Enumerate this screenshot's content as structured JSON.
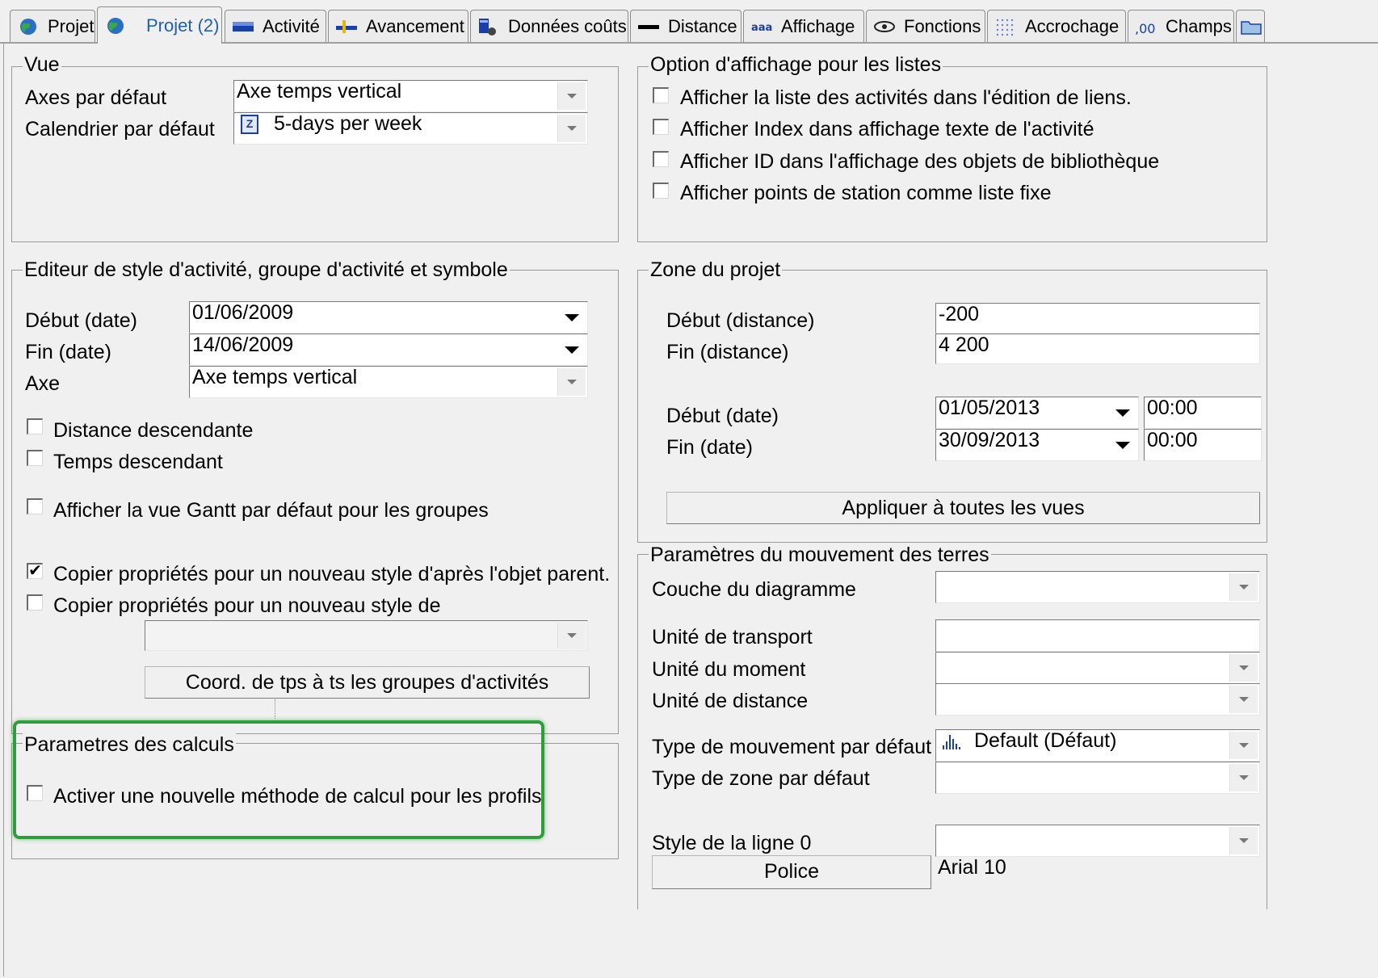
{
  "tabs": [
    {
      "label": "Projet",
      "icon": "globe-icon"
    },
    {
      "label": "Projet (2)",
      "icon": "globe-icon",
      "active": true
    },
    {
      "label": "Activité",
      "icon": "activity-bar-icon"
    },
    {
      "label": "Avancement",
      "icon": "progress-icon"
    },
    {
      "label": "Données coûts",
      "icon": "cost-data-icon"
    },
    {
      "label": "Distance",
      "icon": "distance-icon"
    },
    {
      "label": "Affichage",
      "icon": "display-icon"
    },
    {
      "label": "Fonctions",
      "icon": "functions-eye-icon"
    },
    {
      "label": "Accrochage",
      "icon": "snap-grid-icon"
    },
    {
      "label": "Champs",
      "icon": "fields-icon"
    }
  ],
  "vue": {
    "title": "Vue",
    "axes_label": "Axes par défaut",
    "axes_value": "Axe temps vertical",
    "calendar_label": "Calendrier par défaut",
    "calendar_value": "5-days per week",
    "calendar_icon": "Z"
  },
  "list_options": {
    "title": "Option d'affichage pour les listes",
    "items": [
      {
        "label": "Afficher la liste des activités dans l'édition de liens.",
        "checked": false
      },
      {
        "label": "Afficher Index dans affichage texte de l'activité",
        "checked": false
      },
      {
        "label": "Afficher ID dans l'affichage des objets de bibliothèque",
        "checked": false
      },
      {
        "label": "Afficher points de station comme liste fixe",
        "checked": false
      }
    ]
  },
  "style_editor": {
    "title": "Editeur de style d'activité, groupe d'activité et symbole",
    "start_label": "Début (date)",
    "start_value": "01/06/2009",
    "end_label": "Fin (date)",
    "end_value": "14/06/2009",
    "axis_label": "Axe",
    "axis_value": "Axe temps vertical",
    "check_distance": "Distance descendante",
    "check_time": "Temps descendant",
    "check_gantt": "Afficher la vue Gantt par défaut pour les groupes",
    "check_copy_parent": "Copier propriétés pour un nouveau style d'après l'objet parent.",
    "check_copy_from": "Copier propriétés pour un nouveau style de",
    "copy_from_value": "",
    "coord_button": "Coord. de tps à ts les groupes d'activités"
  },
  "calc_params": {
    "title": "Parametres des calculs",
    "check_new_method": "Activer une nouvelle méthode de calcul pour les profils"
  },
  "project_zone": {
    "title": "Zone du projet",
    "start_dist_label": "Début (distance)",
    "start_dist_value": "-200",
    "end_dist_label": "Fin (distance)",
    "end_dist_value": "4 200",
    "start_date_label": "Début (date)",
    "start_date_value": "01/05/2013",
    "start_time_value": "00:00",
    "end_date_label": "Fin (date)",
    "end_date_value": "30/09/2013",
    "end_time_value": "00:00",
    "apply_button": "Appliquer à toutes les vues"
  },
  "earthworks": {
    "title": "Paramètres du  mouvement des terres",
    "layer_label": "Couche du diagramme",
    "transport_label": "Unité de transport",
    "moment_label": "Unité du moment",
    "distance_unit_label": "Unité de distance",
    "move_type_label": "Type de mouvement par défaut",
    "move_type_value": "Default (Défaut)",
    "zone_type_label": "Type de zone par défaut",
    "line_style_label": "Style de la ligne 0",
    "font_button": "Police",
    "font_value": "Arial 10"
  },
  "colors": {
    "highlight": "#2f9d3a",
    "active_tab_text": "#1f5fb5"
  }
}
